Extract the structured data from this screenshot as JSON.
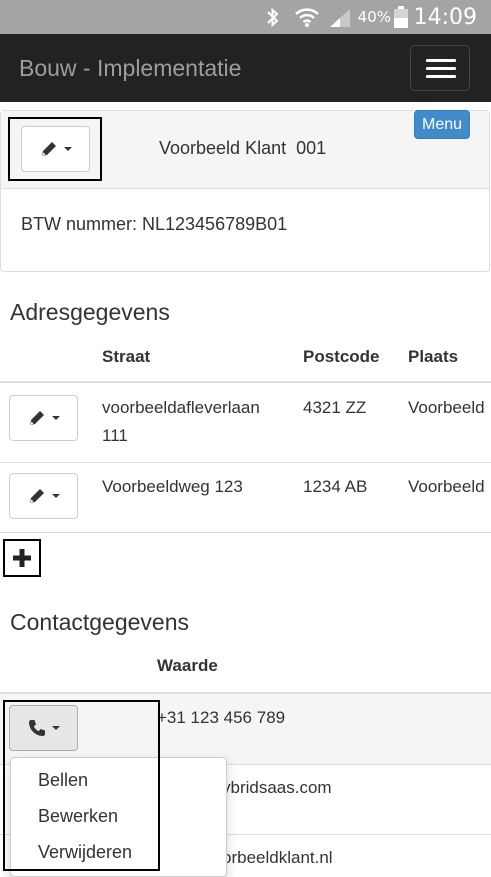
{
  "status_bar": {
    "battery_percent": "40%",
    "time": "14:09",
    "icons": [
      "bluetooth-icon",
      "wifi-icon",
      "signal-icon",
      "battery-icon"
    ]
  },
  "navbar": {
    "brand": "Bouw - Implementatie",
    "toggle_icon": "hamburger-menu-icon"
  },
  "customer": {
    "name": "Voorbeeld Klant  001",
    "menu_label": "Menu",
    "btw": "BTW nummer: NL123456789B01",
    "edit_icon": "pencil-icon"
  },
  "address": {
    "title": "Adresgegevens",
    "columns": [
      "Straat",
      "Postcode",
      "Plaats"
    ],
    "rows": [
      {
        "straat_line1": "voorbeeldafleverlaan",
        "straat_line2": "111",
        "postcode": "4321 ZZ",
        "plaats": "Voorbeeld"
      },
      {
        "straat_line1": "Voorbeeldweg 123",
        "straat_line2": "",
        "postcode": "1234 AB",
        "plaats": "Voorbeeld"
      }
    ],
    "add_icon": "plus-icon"
  },
  "contact": {
    "title": "Contactgegevens",
    "column": "Waarde",
    "rows": [
      {
        "value": "+31 123 456 789",
        "icon": "phone-icon"
      },
      {
        "value": "ybridsaas.com"
      },
      {
        "value": "orbeeldklant.nl"
      }
    ],
    "dropdown": [
      "Bellen",
      "Bewerken",
      "Verwijderen"
    ]
  },
  "colors": {
    "navbar_bg": "#222222",
    "status_bg": "#a4a4a4",
    "menu_badge": "#428bca",
    "panel_heading": "#f5f5f5"
  }
}
